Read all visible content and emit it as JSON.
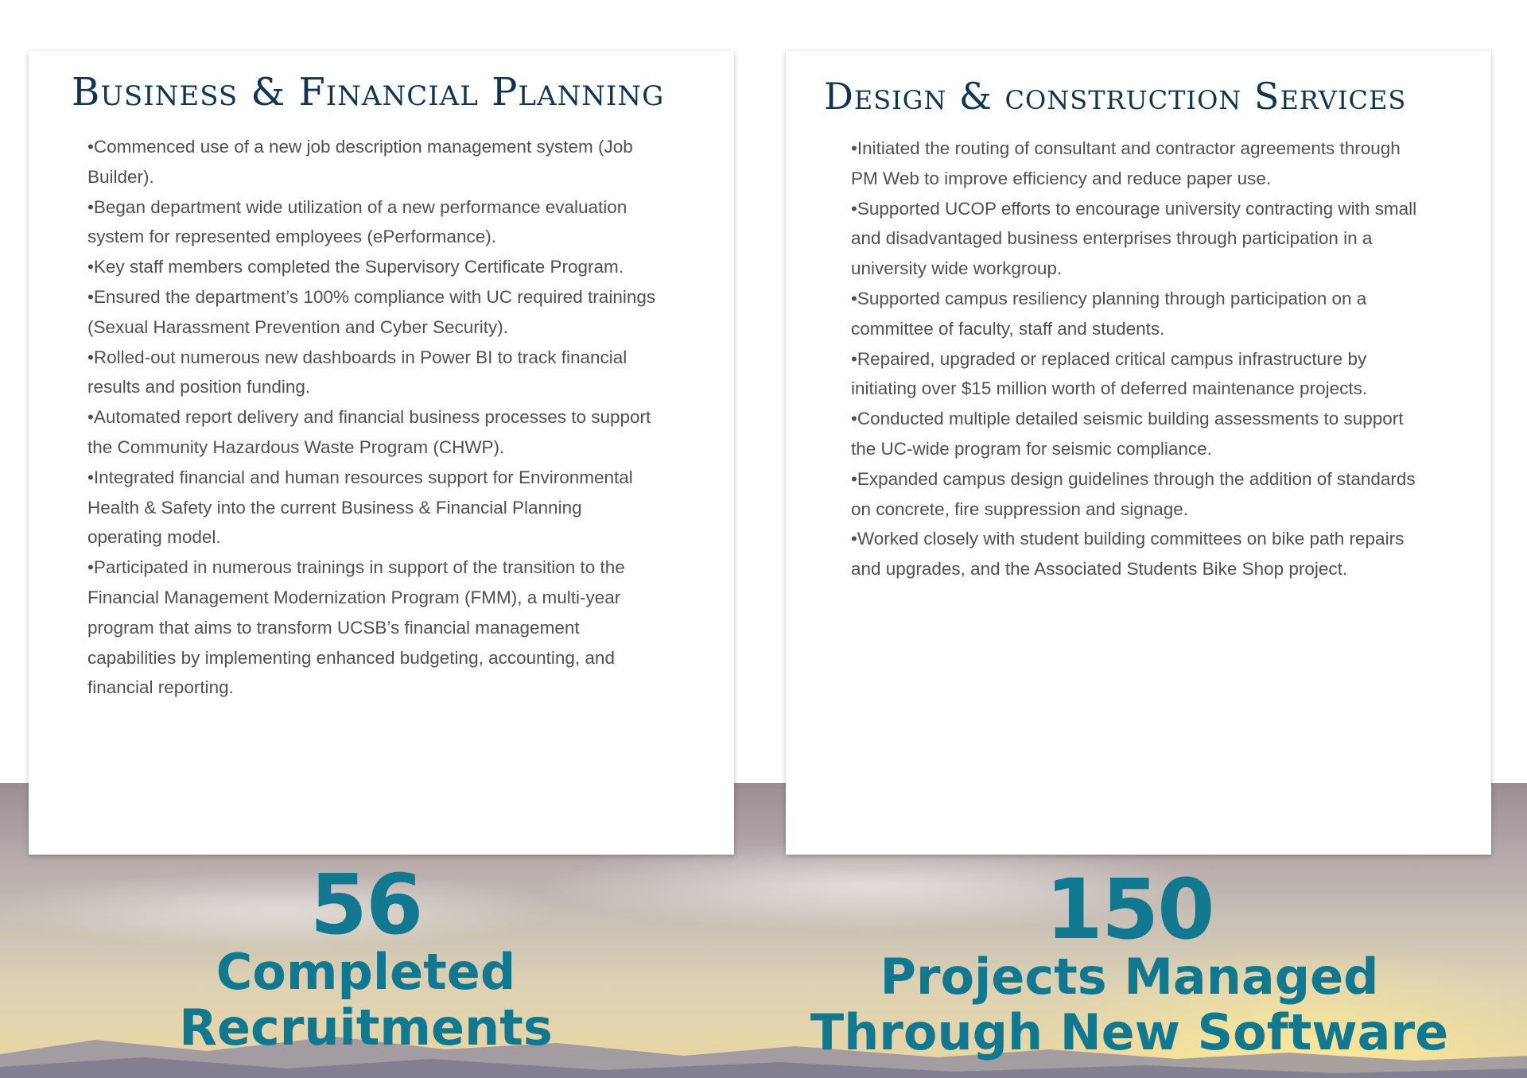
{
  "left_card": {
    "title": "Business & Financial Planning",
    "items": [
      "Commenced use of a new job description management system (Job Builder).",
      "Began department wide utilization of a new performance evaluation system for represented employees (ePerformance).",
      "Key staff members completed the Supervisory Certificate Program.",
      "Ensured the department’s 100% compliance with UC required trainings (Sexual Harassment Prevention and Cyber Security).",
      "Rolled-out numerous new dashboards in Power BI to track financial results and position funding.",
      "Automated report delivery and financial business processes to support the Community Hazardous Waste Program (CHWP).",
      "Integrated financial and human resources support for Environmental Health & Safety into the current Business & Financial Planning operating model.",
      "Participated in numerous trainings in support of the transition to the Financial Management Modernization Program (FMM), a multi-year program that aims to transform UCSB’s financial management capabilities by implementing enhanced budgeting, accounting, and financial reporting."
    ]
  },
  "right_card": {
    "title": "Design & construction Services",
    "items": [
      "Initiated the routing of consultant and contractor agreements through PM Web to improve efficiency and reduce paper use.",
      "Supported UCOP efforts to encourage university contracting with small and disadvantaged business enterprises through participation in a university wide workgroup.",
      "Supported campus resiliency planning through participation on a committee of faculty, staff and students.",
      "Repaired, upgraded or replaced critical campus infrastructure by initiating over $15 million worth of deferred maintenance projects.",
      "Conducted multiple detailed seismic building assessments to support the UC-wide program for seismic compliance.",
      "Expanded campus design guidelines through the addition of standards on concrete, fire suppression and signage.",
      "Worked closely with student building committees on bike path repairs and upgrades, and the Associated Students Bike Shop project."
    ]
  },
  "stats": [
    {
      "number": "56",
      "label": "Completed\nRecruitments"
    },
    {
      "number": "150",
      "label": "Projects Managed\nThrough New Software"
    }
  ],
  "colors": {
    "title": "#0f3553",
    "body_text": "#505050",
    "stat": "#12788f"
  }
}
